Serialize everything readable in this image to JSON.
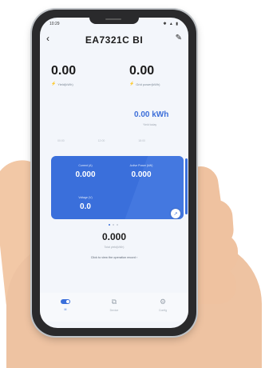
{
  "status": {
    "time": "10:29",
    "icons": "✱ ▲ ▮"
  },
  "header": {
    "title": "EA7321C  BI",
    "back_icon": "‹",
    "edit_icon": "✎"
  },
  "stats": [
    {
      "value": "0.00",
      "label": "Yield(kWh)"
    },
    {
      "value": "0.00",
      "label": "Grid power(kWh)"
    }
  ],
  "energy": {
    "value": "0.00 kWh",
    "label": "Yield today"
  },
  "ticks": [
    "00:00",
    "12:00",
    "18:00"
  ],
  "card": {
    "metrics": [
      {
        "label": "Current (A)",
        "value": "0.000"
      },
      {
        "label": "Active Power (kW)",
        "value": "0.000"
      },
      {
        "label": "Voltage (V)",
        "value": "0.0"
      }
    ],
    "expand_icon": "↗"
  },
  "total": {
    "value": "0.000",
    "label": "Total yield(kWh)"
  },
  "link": "Click to view the operation record ›",
  "tabs": [
    {
      "label": "M",
      "icon": "toggle"
    },
    {
      "label": "Device",
      "icon": "⧉"
    },
    {
      "label": "Config",
      "icon": "⚙"
    }
  ],
  "colors": {
    "accent": "#3a6fdb",
    "card": "#3a6fdb",
    "bolt": "#f5a623"
  }
}
